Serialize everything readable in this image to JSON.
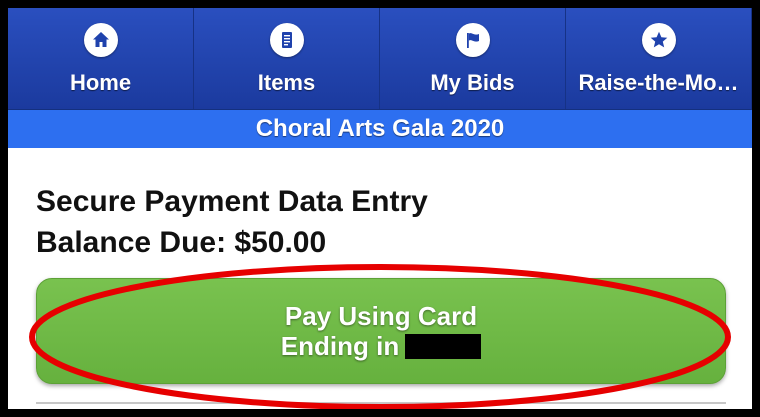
{
  "nav": {
    "items": [
      {
        "label": "Home",
        "icon": "home-icon"
      },
      {
        "label": "Items",
        "icon": "document-icon"
      },
      {
        "label": "My Bids",
        "icon": "flag-icon"
      },
      {
        "label": "Raise-the-Mo…",
        "icon": "star-icon"
      }
    ]
  },
  "event": {
    "title": "Choral Arts Gala 2020"
  },
  "payment": {
    "heading": "Secure Payment Data Entry",
    "balance": "Balance Due: $50.00",
    "button_line1": "Pay Using Card",
    "button_line2": "Ending in"
  },
  "colors": {
    "nav_bg": "#1f42ad",
    "event_bar": "#2d6ff0",
    "pay_button": "#6cb846",
    "annotation": "#e60000"
  }
}
